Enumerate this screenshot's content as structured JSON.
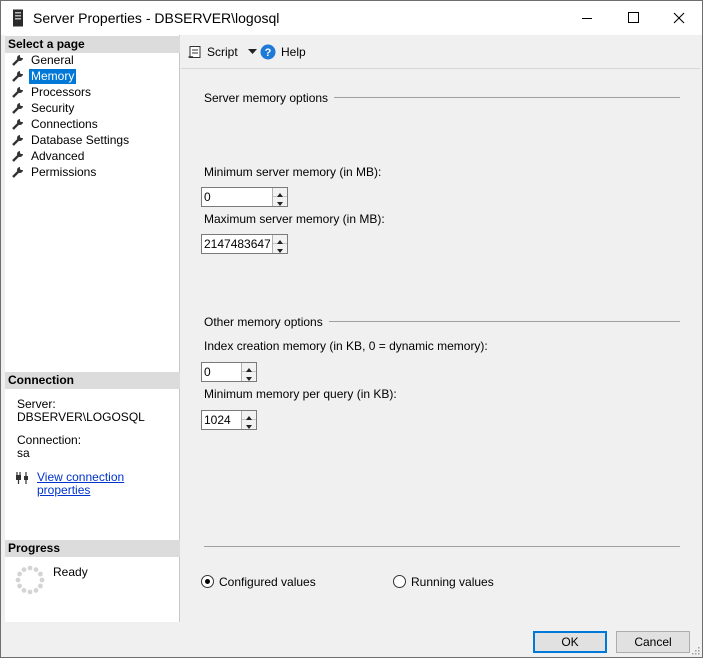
{
  "window": {
    "title": "Server Properties - DBSERVER\\logosql"
  },
  "sidebar": {
    "select_page_header": "Select a page",
    "items": [
      {
        "label": "General"
      },
      {
        "label": "Memory",
        "selected": true
      },
      {
        "label": "Processors"
      },
      {
        "label": "Security"
      },
      {
        "label": "Connections"
      },
      {
        "label": "Database Settings"
      },
      {
        "label": "Advanced"
      },
      {
        "label": "Permissions"
      }
    ],
    "connection_header": "Connection",
    "server_label": "Server:",
    "server_value": "DBSERVER\\LOGOSQL",
    "connection_label": "Connection:",
    "connection_value": "sa",
    "view_connection_link": "View connection properties",
    "progress_header": "Progress",
    "progress_status": "Ready"
  },
  "toolbar": {
    "script_label": "Script",
    "help_label": "Help"
  },
  "memory": {
    "server_group_title": "Server memory options",
    "min_server_label": "Minimum server memory (in MB):",
    "min_server_value": "0",
    "max_server_label": "Maximum server memory (in MB):",
    "max_server_value": "2147483647",
    "other_group_title": "Other memory options",
    "index_creation_label": "Index creation memory (in KB, 0 = dynamic memory):",
    "index_creation_value": "0",
    "min_query_label": "Minimum memory per query (in KB):",
    "min_query_value": "1024",
    "configured_label": "Configured values",
    "running_label": "Running values",
    "selected_mode": "configured"
  },
  "buttons": {
    "ok": "OK",
    "cancel": "Cancel"
  },
  "colors": {
    "accent": "#0078d7",
    "link": "#0033cc"
  }
}
